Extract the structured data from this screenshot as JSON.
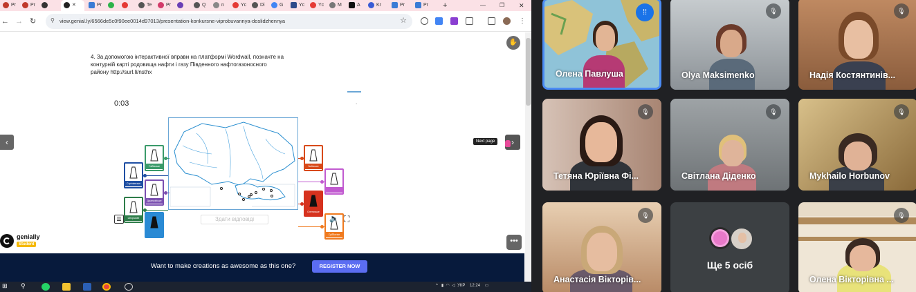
{
  "browser": {
    "tabs": [
      "Pr",
      "Pr",
      "",
      "Pr",
      "",
      "Te",
      "Pr",
      "Q",
      "n",
      "Yc",
      "Di",
      "G",
      "Yc",
      "Yc",
      "M",
      "A",
      "Kr",
      "Pr",
      "Pr"
    ],
    "url": "view.genial.ly/6566de5c0f90ee0014d97013/presentation-konkursne-viprobuvannya-doslidzhennya"
  },
  "slide": {
    "instruction": "4. За допомогою інтерактивної вправи на платформі Wordwall, позначте на контурній карті родовища нафти і газу Південного нафтогазоносного району http://surl.li/nsthx",
    "timer": "0:03",
    "submit_label": "Здати відповіді",
    "next_tooltip": "Next page"
  },
  "cards": [
    {
      "label": "Глібівське",
      "color": "#3a9a6a"
    },
    {
      "label": "Стрілківське",
      "color": "#1f4fa3"
    },
    {
      "label": "Джанкойське",
      "color": "#7a4fb0"
    },
    {
      "label": "Штормове",
      "color": "#2e7d4a"
    },
    {
      "label": "",
      "color": "#2a8ad4"
    },
    {
      "label": "Зміїнське",
      "color": "#d84a1a"
    },
    {
      "label": "",
      "color": "#c15ad0"
    },
    {
      "label": "Олениське",
      "color": "#d6321e"
    },
    {
      "label": "Субботіне",
      "color": "#f07a1e"
    }
  ],
  "genially": {
    "brand": "genially",
    "badge": "Student"
  },
  "banner": {
    "text": "Want to make creations as awesome as this one?",
    "button": "REGISTER NOW"
  },
  "taskbar": {
    "lang": "УКР",
    "time": "12:24"
  },
  "meet": {
    "participants": [
      {
        "name": "Олена Павлуша"
      },
      {
        "name": "Olya Maksimenko"
      },
      {
        "name": "Надія Костянтинів..."
      },
      {
        "name": "Тетяна Юріївна Фі..."
      },
      {
        "name": "Світлана Діденко"
      },
      {
        "name": "Mykhailo Horbunov"
      },
      {
        "name": "Анастасія Вікторів..."
      },
      {
        "name": "Ще 5 осіб"
      },
      {
        "name": "Олена Вікторівна ..."
      }
    ]
  },
  "colors": {
    "accent": "#1a73e8",
    "banner_bg": "#071a3c",
    "register": "#5b6df2"
  }
}
